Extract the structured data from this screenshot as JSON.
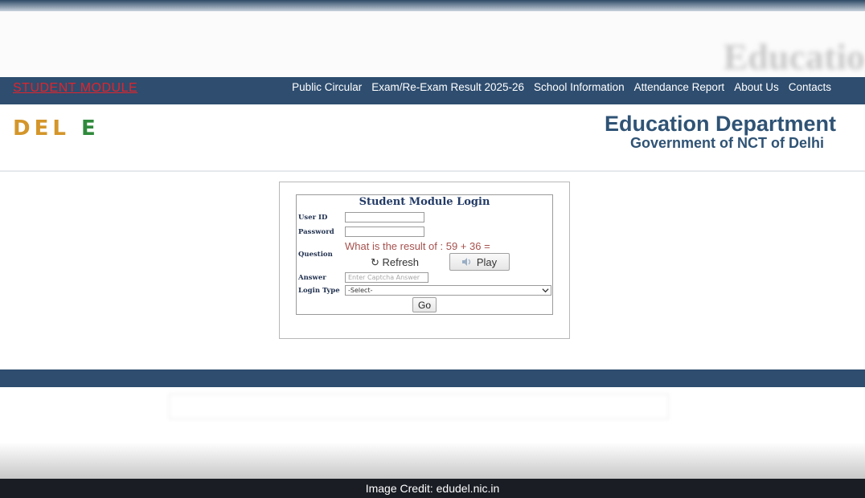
{
  "header": {
    "blurred_title": "Educatio"
  },
  "nav": {
    "module_link": "STUDENT MODULE",
    "items": [
      "Public Circular",
      "Exam/Re-Exam Result 2025-26",
      "School Information",
      "Attendance Report",
      "About Us",
      "Contacts"
    ]
  },
  "brand": {
    "logo_part1": "DEL",
    "logo_part2": "E",
    "dept_title": "Education Department",
    "dept_subtitle": "Government of NCT of Delhi"
  },
  "login": {
    "title": "Student Module Login",
    "labels": {
      "user_id": "User ID",
      "password": "Password",
      "question": "Question",
      "answer": "Answer",
      "login_type": "Login Type"
    },
    "user_id_value": "",
    "password_value": "",
    "captcha_question": "What is the result of : 59 + 36 =",
    "refresh_label": "↻ Refresh",
    "play_label": "Play",
    "answer_placeholder": "Enter Captcha Answer",
    "login_type_selected": "-Select-",
    "go_label": "Go"
  },
  "credit": {
    "text": "Image Credit: edudel.nic.in"
  },
  "colors": {
    "nav_bg": "#2e4d6f",
    "module_link": "#e0242c",
    "dept_title": "#2f5375",
    "logo_gold": "#d4962a",
    "logo_green": "#2f8a3c",
    "captcha_text": "#a6514d"
  }
}
